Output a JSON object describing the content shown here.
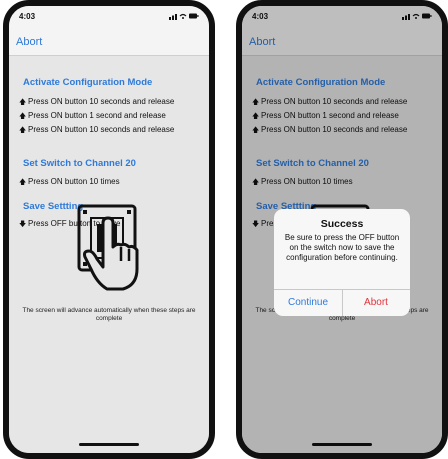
{
  "status": {
    "time": "4:03",
    "icons": "signal-wifi-battery"
  },
  "nav": {
    "abort_label": "Abort"
  },
  "sections": {
    "activate": {
      "title": "Activate Configuration Mode",
      "steps": [
        {
          "arrow": "up",
          "text": "Press ON button 10 seconds and release"
        },
        {
          "arrow": "up",
          "text": "Press ON button 1 second and release"
        },
        {
          "arrow": "up",
          "text": "Press ON button 10 seconds and release"
        }
      ]
    },
    "channel": {
      "title": "Set Switch to Channel 20",
      "steps": [
        {
          "arrow": "up",
          "text": "Press ON button 10 times"
        }
      ]
    },
    "save": {
      "title": "Save Settting",
      "steps": [
        {
          "arrow": "down",
          "text": "Press OFF button to Save"
        }
      ]
    }
  },
  "advance_text": "The screen will advance automatically when these steps are complete",
  "alert": {
    "title": "Success",
    "message": "Be sure to press the OFF button on the switch now to save the configuration before continuing.",
    "continue_label": "Continue",
    "abort_label": "Abort"
  },
  "colors": {
    "accent": "#2f7ad8",
    "destructive": "#e0333a",
    "background": "#e6e6e6"
  },
  "icons": {
    "up_arrow": "up-arrow-icon",
    "down_arrow": "down-arrow-icon",
    "illustration": "hand-pressing-switch-icon"
  }
}
